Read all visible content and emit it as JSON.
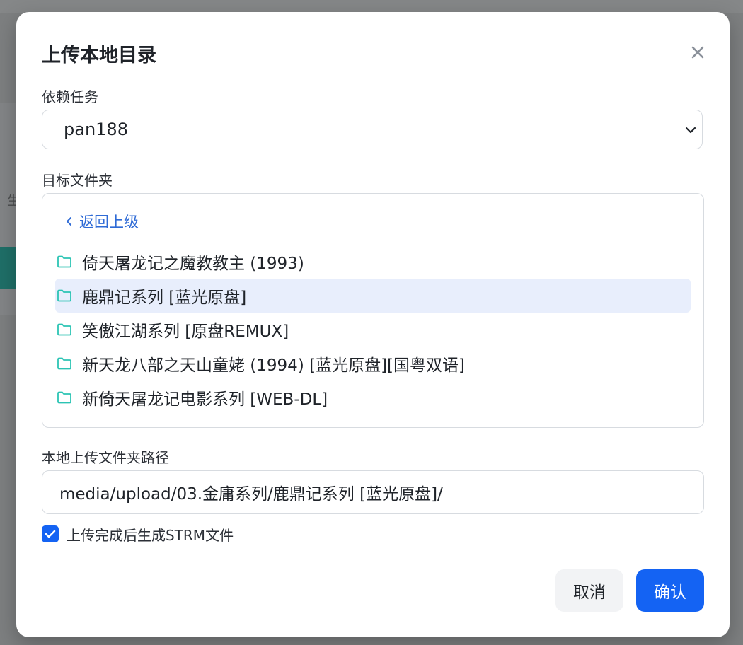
{
  "background": {
    "partial_char": "生"
  },
  "dialog": {
    "title": "上传本地目录",
    "close_icon": "close-icon"
  },
  "dependency": {
    "label": "依赖任务",
    "selected": "pan188"
  },
  "target_folder": {
    "label": "目标文件夹",
    "back_label": "返回上级",
    "folders": [
      {
        "name": "倚天屠龙记之魔教教主 (1993)",
        "selected": false
      },
      {
        "name": "鹿鼎记系列 [蓝光原盘]",
        "selected": true
      },
      {
        "name": "笑傲江湖系列 [原盘REMUX]",
        "selected": false
      },
      {
        "name": "新天龙八部之天山童姥 (1994) [蓝光原盘][国粤双语]",
        "selected": false
      },
      {
        "name": "新倚天屠龙记电影系列 [WEB-DL]",
        "selected": false
      }
    ]
  },
  "local_path": {
    "label": "本地上传文件夹路径",
    "value": "media/upload/03.金庸系列/鹿鼎记系列 [蓝光原盘]/"
  },
  "generate_strm": {
    "checked": true,
    "label": "上传完成后生成STRM文件"
  },
  "buttons": {
    "cancel": "取消",
    "confirm": "确认"
  },
  "colors": {
    "primary": "#1463f3",
    "folder_icon": "#2cc4b4",
    "selected_row": "#e8eefc",
    "link": "#2f6bd6"
  }
}
